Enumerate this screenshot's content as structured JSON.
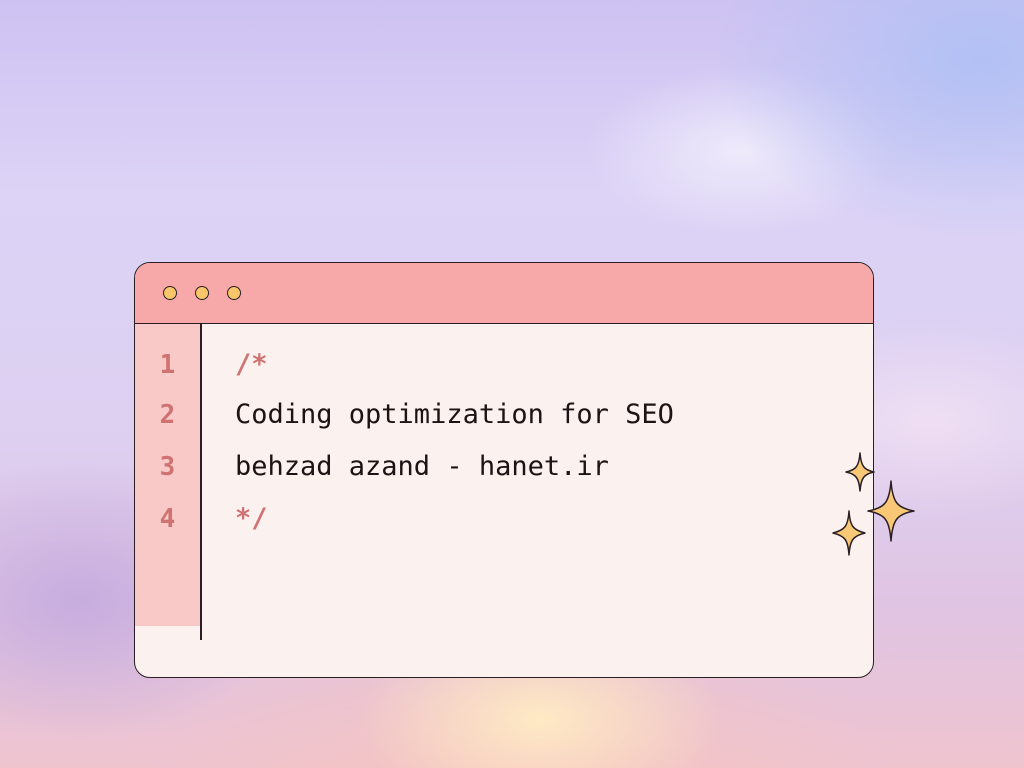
{
  "editor": {
    "lines": [
      {
        "number": "1",
        "text": "/*"
      },
      {
        "number": "2",
        "text": "Coding optimization for SEO"
      },
      {
        "number": "3",
        "text": "behzad azand - hanet.ir"
      },
      {
        "number": "4",
        "text": "*/"
      }
    ]
  },
  "colors": {
    "titlebar": "#f7a9a9",
    "editor_bg": "#fbf1ee",
    "gutter_bg": "#f8c9c6",
    "line_number": "#cf7272",
    "window_dot": "#f7c66a",
    "sparkle": "#f8c876"
  },
  "icons": {
    "window_controls": [
      "window-dot-icon",
      "window-dot-icon",
      "window-dot-icon"
    ],
    "decoration": [
      "sparkle-icon",
      "sparkle-icon",
      "sparkle-icon"
    ]
  }
}
